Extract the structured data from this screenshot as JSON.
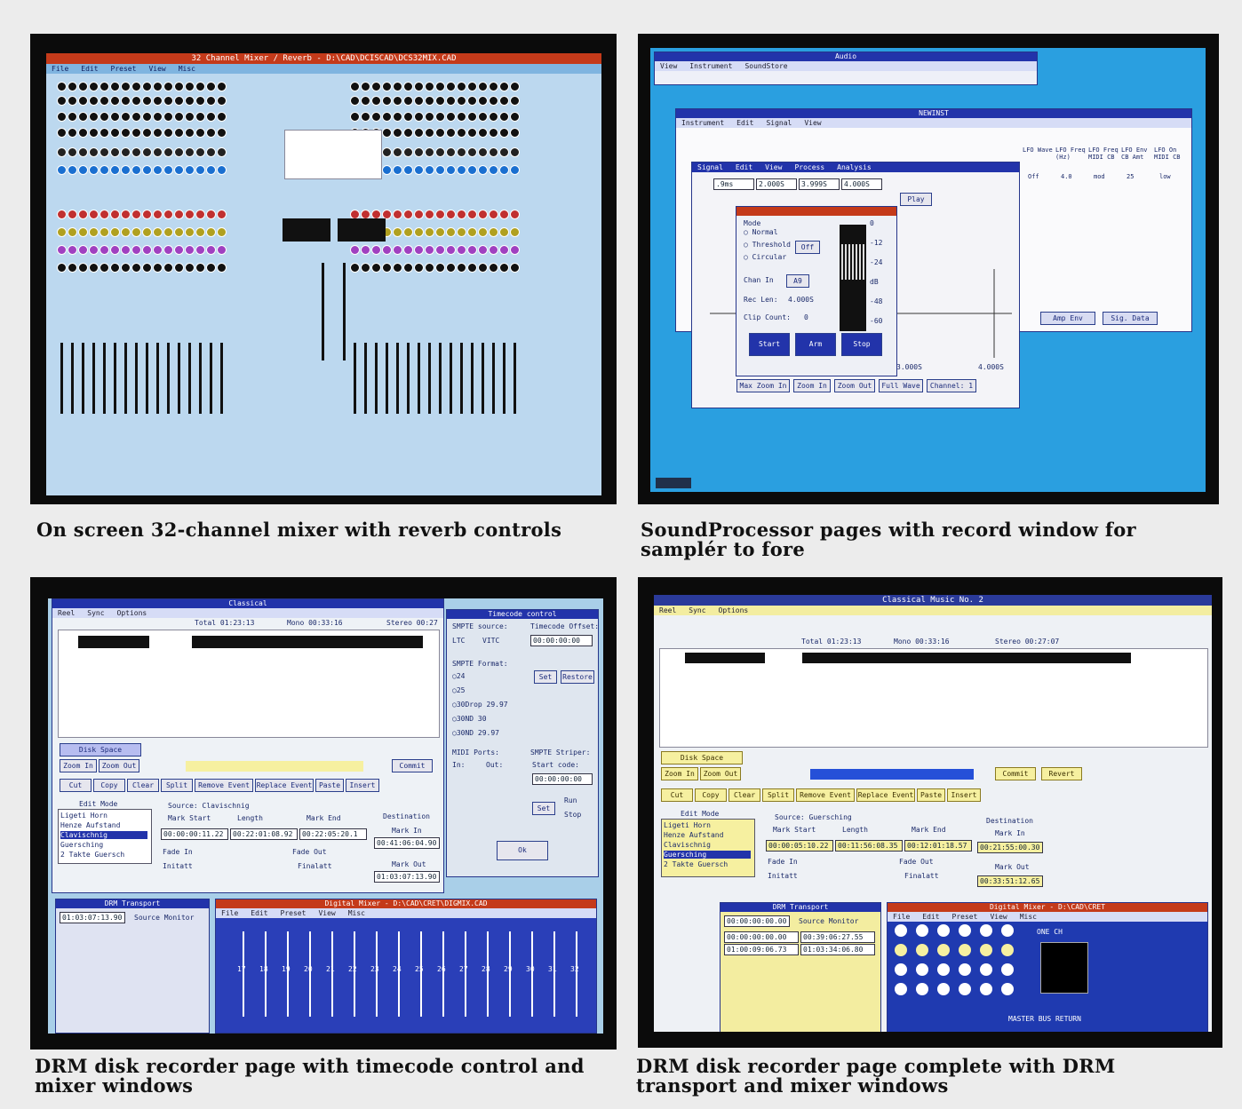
{
  "captions": {
    "top_left": "On screen 32-channel mixer with reverb controls",
    "top_right": "SoundProcessor pages with record window for samplér to fore",
    "bottom_left": "DRM disk recorder page with timecode control and mixer windows",
    "bottom_right": "DRM disk recorder page complete with DRM transport and mixer windows"
  },
  "mixer": {
    "title": "32 Channel Mixer / Reverb - D:\\CAD\\DCISCAD\\DCS32MIX.CAD",
    "menu": [
      "File",
      "Edit",
      "Preset",
      "View",
      "Misc"
    ]
  },
  "soundprocessor": {
    "back_title": "Audio",
    "back_menu": [
      "View",
      "Instrument",
      "SoundStore"
    ],
    "instrument_title": "NEWINST",
    "instrument_menu": [
      "Instrument",
      "Edit",
      "Signal",
      "View"
    ],
    "lfo_headers": [
      "LFO Wave",
      "LFO Freq (Hz)",
      "LFO Freq MIDI CB",
      "LFO Env CB Amt",
      "LFO On MIDI CB"
    ],
    "lfo_values": [
      "Off",
      "4.0",
      "mod",
      "25",
      "low"
    ],
    "signal_menu": [
      "Signal",
      "Edit",
      "View",
      "Process",
      "Analysis"
    ],
    "time_fields": [
      ".9ms",
      "2.000S",
      "3.999S",
      "4.000S"
    ],
    "play_label": "Play",
    "mode_label": "Mode",
    "modes": [
      "Normal",
      "Threshold",
      "Circular"
    ],
    "off_label": "Off",
    "chan_in_label": "Chan In",
    "chan_in_value": "A9",
    "rec_len_label": "Rec Len:",
    "rec_len_value": "4.000S",
    "clip_count_label": "Clip Count:",
    "clip_count_value": "0",
    "meter_scale": [
      "0",
      "-12",
      "-24",
      "dB",
      "-48",
      "-60"
    ],
    "record_buttons": [
      "Start",
      "Arm",
      "Stop"
    ],
    "zoom_buttons": [
      "Max Zoom In",
      "Zoom In",
      "Zoom Out",
      "Full Wave",
      "Channel: 1"
    ],
    "axis_labels": [
      "3.000S",
      "4.000S"
    ],
    "side_buttons": [
      "Amp Env",
      "Sig. Data"
    ]
  },
  "drm_left": {
    "title": "Classical",
    "menu": [
      "Reel",
      "Sync",
      "Options"
    ],
    "total": "Total 01:23:13",
    "mono": "Mono 00:33:16",
    "stereo": "Stereo 00:27",
    "disk_space": "Disk Space",
    "zoom_in": "Zoom In",
    "zoom_out": "Zoom Out",
    "commit": "Commit",
    "edit_buttons": [
      "Cut",
      "Copy",
      "Clear",
      "Split",
      "Remove Event",
      "Replace Event",
      "Paste",
      "Insert"
    ],
    "edit_mode": "Edit Mode",
    "source_list": [
      "Ligeti Horn",
      "Henze Aufstand",
      "Clavischnig",
      "Guersching",
      "2 Takte Guersch"
    ],
    "source_label": "Source: Clavischnig",
    "columns": [
      "Mark Start",
      "Length",
      "Mark End"
    ],
    "times": [
      "00:00:00:11.22",
      "00:22:01:08.92",
      "00:22:05:20.1"
    ],
    "fade_in": "Fade In",
    "fade_out": "Fade Out",
    "initatt": "Initatt",
    "finalatt": "Finalatt",
    "destination": "Destination",
    "mark_in": "Mark In",
    "mark_out": "Mark Out",
    "dest_times": [
      "00:41:06:04.90",
      "01:03:07:13.90"
    ],
    "tc_title": "Timecode control",
    "tc_source": "SMPTE source:",
    "tc_offset": "Timecode Offset:",
    "tc_ltc": "LTC",
    "tc_vitc": "VITC",
    "tc_offset_value": "00:00:00:00",
    "tc_set": "Set",
    "tc_restore": "Restore",
    "tc_format": "SMPTE Format:",
    "tc_formats": [
      "24",
      "25",
      "30Drop 29.97",
      "30ND 30",
      "30ND 29.97"
    ],
    "midi_ports": "MIDI Ports:",
    "striper": "SMPTE Striper:",
    "in_label": "In:",
    "out_label": "Out:",
    "start_code": "Start code:",
    "start_code_value": "00:00:00:00",
    "run": "Run",
    "stop": "Stop",
    "ok": "Ok",
    "transport_title": "DRM Transport",
    "transport_time": "01:03:07:13.90",
    "source_monitor": "Source Monitor",
    "mixer_title": "Digital Mixer - D:\\CAD\\CRET\\DIGMIX.CAD",
    "mixer_menu": [
      "File",
      "Edit",
      "Preset",
      "View",
      "Misc"
    ],
    "mixer_channels": [
      "17",
      "18",
      "19",
      "20",
      "21",
      "22",
      "23",
      "24",
      "25",
      "26",
      "27",
      "28",
      "29",
      "30",
      "31",
      "32"
    ]
  },
  "drm_right": {
    "title": "Classical Music No. 2",
    "menu": [
      "Reel",
      "Sync",
      "Options"
    ],
    "total": "Total 01:23:13",
    "mono": "Mono 00:33:16",
    "stereo": "Stereo 00:27:07",
    "disk_space": "Disk Space",
    "zoom_in": "Zoom In",
    "zoom_out": "Zoom Out",
    "commit": "Commit",
    "revert": "Revert",
    "edit_buttons": [
      "Cut",
      "Copy",
      "Clear",
      "Split",
      "Remove Event",
      "Replace Event",
      "Paste",
      "Insert"
    ],
    "edit_mode": "Edit Mode",
    "source_list": [
      "Ligeti Horn",
      "Henze Aufstand",
      "Clavischnig",
      "Guersching",
      "2 Takte Guersch"
    ],
    "source_label": "Source: Guersching",
    "columns": [
      "Mark Start",
      "Length",
      "Mark End"
    ],
    "times": [
      "00:00:05:10.22",
      "00:11:56:08.35",
      "00:12:01:18.57"
    ],
    "fade_in": "Fade In",
    "fade_out": "Fade Out",
    "initatt": "Initatt",
    "finalatt": "Finalatt",
    "destination": "Destination",
    "mark_in": "Mark In",
    "mark_out": "Mark Out",
    "dest_times": [
      "00:21:55:00.30",
      "00:33:51:12.65"
    ],
    "transport_title": "DRM Transport",
    "transport_time": "00:00:00:00.00",
    "source_monitor": "Source Monitor",
    "transport_times": [
      "00:00:00:00.00",
      "00:39:06:27.55",
      "01:00:09:06.73",
      "01:03:34:06.80"
    ],
    "mixer_title": "Digital Mixer - D:\\CAD\\CRET",
    "mixer_menu": [
      "File",
      "Edit",
      "Preset",
      "View",
      "Misc"
    ],
    "master_label": "MASTER BUS RETURN",
    "one_ch": "ONE CH"
  }
}
